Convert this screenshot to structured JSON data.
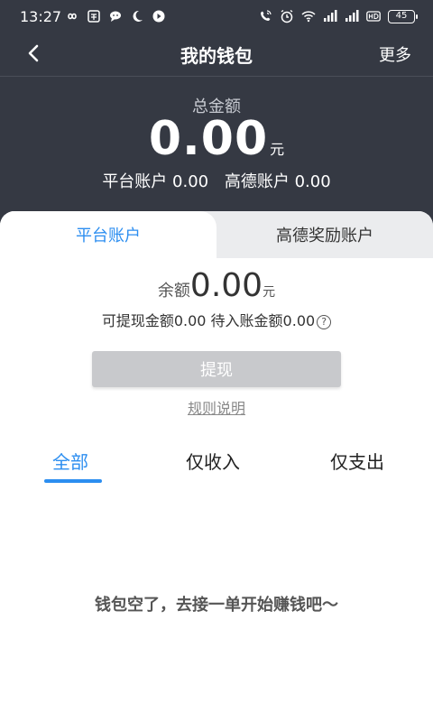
{
  "status_bar": {
    "time": "13:27",
    "battery": "45",
    "left_icons": [
      "infinity-icon",
      "app-icon",
      "chat-icon",
      "moon-icon",
      "play-icon"
    ],
    "right_icons": [
      "phone-wifi-icon",
      "alarm-icon",
      "wifi-icon",
      "signal-icon",
      "signal-icon",
      "hd-icon"
    ]
  },
  "nav": {
    "title": "我的钱包",
    "more_label": "更多"
  },
  "summary": {
    "total_label": "总金额",
    "total_amount": "0.00",
    "total_unit": "元",
    "platform_account": "平台账户 0.00",
    "gaode_account": "高德账户 0.00"
  },
  "tabs": {
    "active": "平台账户",
    "inactive": "高德奖励账户"
  },
  "balance": {
    "label": "余额",
    "amount": "0.00",
    "unit": "元",
    "withdrawable": "可提现金额0.00",
    "pending": "待入账金额0.00",
    "help_glyph": "?"
  },
  "actions": {
    "withdraw_label": "提现",
    "rules_label": "规则说明"
  },
  "filters": {
    "all": "全部",
    "income": "仅收入",
    "expense": "仅支出"
  },
  "empty_message": "钱包空了，去接一单开始赚钱吧～",
  "colors": {
    "header_bg": "#353943",
    "accent": "#2c8ef0",
    "tab_inactive_bg": "#ebecee",
    "button_disabled": "#c8c9cc"
  }
}
